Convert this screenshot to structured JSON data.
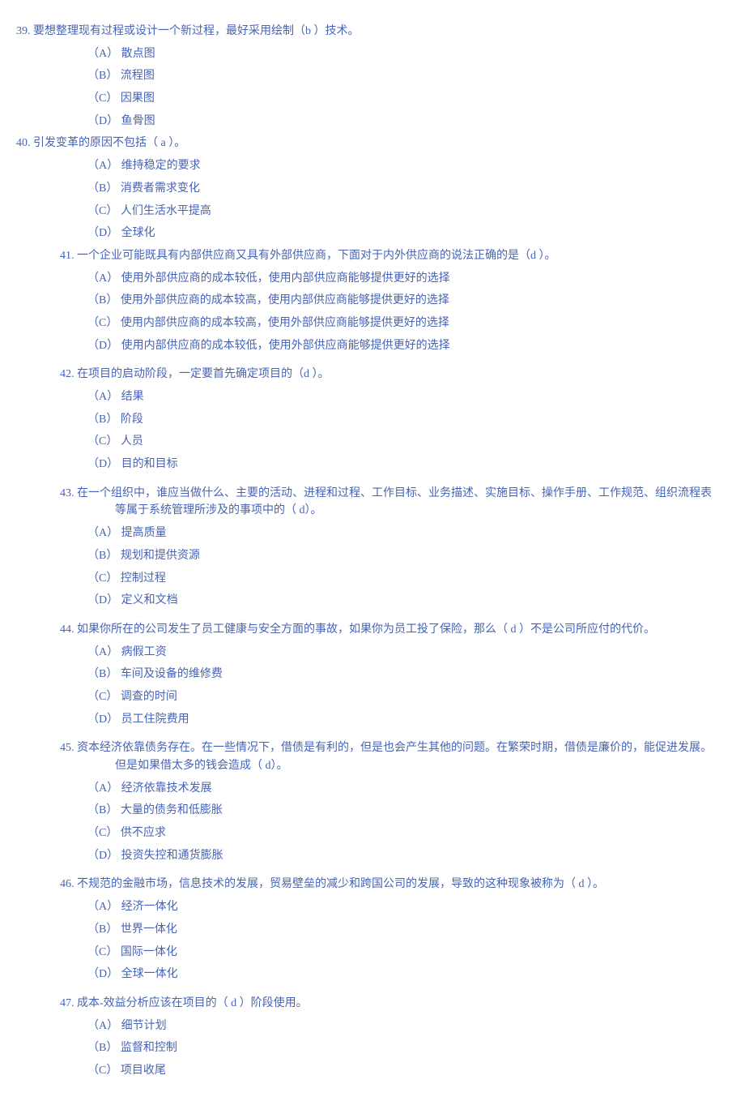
{
  "questions": [
    {
      "num": "39.",
      "stem": " 要想整理现有过程或设计一个新过程，最好采用绘制（b  ）技术。",
      "layout": "outer",
      "options": [
        "（A）  散点图",
        "（B）  流程图",
        "（C）  因果图",
        "（D）  鱼骨图"
      ]
    },
    {
      "num": "40.",
      "stem": " 引发变革的原因不包括（ a ）。",
      "layout": "outer",
      "options": [
        "（A）  维持稳定的要求",
        "（B）  消费者需求变化",
        "（C）  人们生活水平提高",
        "（D）  全球化"
      ]
    },
    {
      "num": "41.",
      "stem": "   一个企业可能既具有内部供应商又具有外部供应商，下面对于内外供应商的说法正确的是（d ）。",
      "layout": "inner",
      "options": [
        "（A）  使用外部供应商的成本较低，使用内部供应商能够提供更好的选择",
        "（B）  使用外部供应商的成本较高，使用内部供应商能够提供更好的选择",
        "（C）  使用内部供应商的成本较高，使用外部供应商能够提供更好的选择",
        "（D）  使用内部供应商的成本较低，使用外部供应商能够提供更好的选择"
      ],
      "spacer": true
    },
    {
      "num": "42.",
      "stem": "   在项目的启动阶段，一定要首先确定项目的（d  ）。",
      "layout": "inner",
      "options": [
        "（A）  结果",
        "（B）  阶段",
        "（C）  人员",
        "（D）  目的和目标"
      ],
      "spacer": true
    },
    {
      "num": "43.",
      "stem": "   在一个组织中，谁应当做什么、主要的活动、进程和过程、工作目标、业务描述、实施目标、操作手册、工作规范、组织流程表等属于系统管理所涉及的事项中的（ d）。",
      "layout": "inner-wrap",
      "options": [
        "（A）  提高质量",
        "（B）  规划和提供资源",
        "（C）  控制过程",
        "（D）  定义和文档"
      ],
      "spacer": true
    },
    {
      "num": "44.",
      "stem": "   如果你所在的公司发生了员工健康与安全方面的事故，如果你为员工投了保险，那么（ d ）不是公司所应付的代价。",
      "layout": "inner-wrap",
      "options": [
        "（A）  病假工资",
        "（B）  车间及设备的维修费",
        "（C）  调查的时间",
        "（D）  员工住院费用"
      ],
      "spacer": true
    },
    {
      "num": "45.",
      "stem": "   资本经济依靠债务存在。在一些情况下，借债是有利的，但是也会产生其他的问题。在繁荣时期，借债是廉价的，能促进发展。但是如果借太多的钱会造成（ d）。",
      "layout": "inner-wrap",
      "options": [
        "（A）  经济依靠技术发展",
        "（B）  大量的债务和低膨胀",
        "（C）  供不应求",
        "（D）  投资失控和通货膨胀"
      ],
      "spacer": true
    },
    {
      "num": "46.",
      "stem": "   不规范的金融市场，信息技术的发展，贸易壁垒的减少和跨国公司的发展，导致的这种现象被称为（ d ）。",
      "layout": "inner",
      "options": [
        "（A）  经济一体化",
        "（B）  世界一体化",
        "（C）  国际一体化",
        "（D）  全球一体化"
      ],
      "spacer": true
    },
    {
      "num": "47.",
      "stem": "   成本-效益分析应该在项目的（ d ）阶段使用。",
      "layout": "inner",
      "options": [
        "（A）  细节计划",
        "（B）  监督和控制",
        "（C）  项目收尾"
      ]
    }
  ]
}
